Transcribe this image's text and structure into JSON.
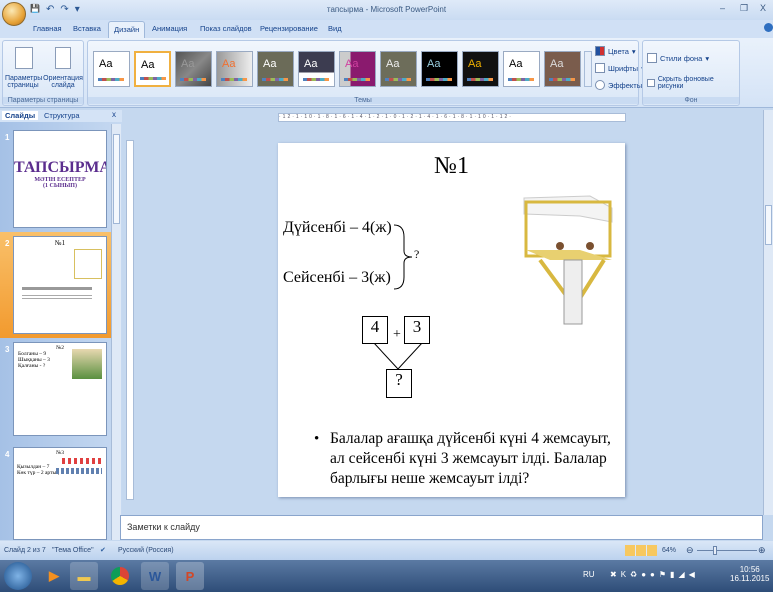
{
  "window": {
    "title": "тапсырма - Microsoft PowerPoint",
    "minimize": "–",
    "restore": "❐",
    "close": "X"
  },
  "qat": {
    "save": "💾",
    "undo": "↶",
    "redo": "↷",
    "more": "▾"
  },
  "tabs": [
    "Главная",
    "Вставка",
    "Дизайн",
    "Анимация",
    "Показ слайдов",
    "Рецензирование",
    "Вид"
  ],
  "ribbon": {
    "page_setup": {
      "params": "Параметры страницы",
      "orientation": "Ориентация слайда",
      "group": "Параметры страницы"
    },
    "themes": {
      "group": "Темы",
      "colors": "Цвета",
      "fonts": "Шрифты",
      "effects": "Эффекты",
      "sample": "Aa"
    },
    "background": {
      "styles": "Стили фона",
      "hide": "Скрыть фоновые рисунки",
      "group": "Фон"
    }
  },
  "left_panel": {
    "tab_slides": "Слайды",
    "tab_outline": "Структура",
    "close": "x",
    "slides": [
      {
        "n": "1",
        "title": "ТАПСЫРМА",
        "sub1": "МӘТІН ЕСЕПТЕР",
        "sub2": "(1 СЫНЫП)"
      },
      {
        "n": "2",
        "title": "№1"
      },
      {
        "n": "3",
        "title": "№2",
        "lines": [
          "Болганы – 9",
          "Шыққаны – 3",
          "Қалғаны - ?"
        ]
      },
      {
        "n": "4",
        "title": "№3",
        "lines": [
          "Қызылдан – 7",
          "Көк түр – 2 артық"
        ]
      }
    ]
  },
  "ruler": "·12·1·10·1·8·1·6·1·4·1·2·1·0·1·2·1·4·1·6·1·8·1·10·1·12·",
  "slide": {
    "title": "№1",
    "line1": "Дүйсенбі – 4(ж)",
    "line2": "Сейсенбі – 3(ж)",
    "brace_q": "?",
    "box1": "4",
    "plus": "+",
    "box2": "3",
    "result": "?",
    "bullet": "Балалар ағашқа дүйсенбі күні 4 жемсауыт, ал сейсенбі күні 3 жемсауыт ілді. Балалар барлығы неше жемсауыт ілді?"
  },
  "notes": {
    "placeholder": "Заметки к слайду"
  },
  "status": {
    "slide": "Слайд 2 из 7",
    "theme": "\"Тема Office\"",
    "lang": "Русский (Россия)",
    "zoom": "64%",
    "zoom_value": 64
  },
  "taskbar": {
    "lang": "RU",
    "time": "10:56",
    "date": "16.11.2015"
  }
}
